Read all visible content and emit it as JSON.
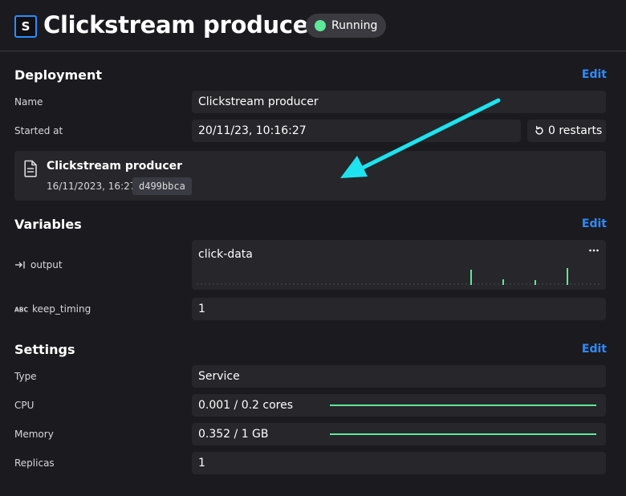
{
  "header": {
    "app_letter": "S",
    "title": "Clickstream producer",
    "status": "Running",
    "status_color": "#5ee89a"
  },
  "deployment": {
    "title": "Deployment",
    "edit_label": "Edit",
    "name_label": "Name",
    "name_value": "Clickstream producer",
    "started_label": "Started at",
    "started_value": "20/11/23, 10:16:27",
    "restarts_label": "0 restarts",
    "file": {
      "icon": "document-icon",
      "name": "Clickstream producer",
      "date": "16/11/2023, 16:27",
      "commit": "d499bbca"
    }
  },
  "variables": {
    "title": "Variables",
    "edit_label": "Edit",
    "items": [
      {
        "icon": "output-arrow-icon",
        "label": "output",
        "value": "click-data"
      },
      {
        "icon": "abc-text-icon",
        "label": "keep_timing",
        "value": "1"
      }
    ]
  },
  "settings": {
    "title": "Settings",
    "edit_label": "Edit",
    "type_label": "Type",
    "type_value": "Service",
    "cpu_label": "CPU",
    "cpu_value": "0.001 / 0.2 cores",
    "memory_label": "Memory",
    "memory_value": "0.352 / 1 GB",
    "replicas_label": "Replicas",
    "replicas_value": "1"
  },
  "colors": {
    "accent": "#2d8cff",
    "annotation_arrow": "#1ee3ef",
    "metric": "#5ee89a"
  }
}
